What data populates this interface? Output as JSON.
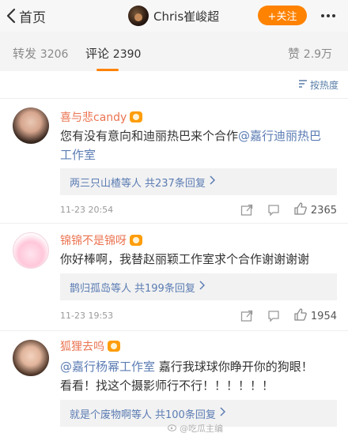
{
  "header": {
    "back_label": "首页",
    "username": "Chris崔峻超",
    "follow_label": "+关注",
    "more_icon": "more-icon"
  },
  "stats": {
    "repost_label": "转发",
    "repost_count": "3206",
    "comment_label": "评论",
    "comment_count": "2390",
    "like_label": "赞",
    "like_count": "2.9万"
  },
  "sort": {
    "label": "按热度"
  },
  "comments": [
    {
      "user": "喜与悲candy",
      "text_line1": "您有没有意向和迪丽热巴来个合作",
      "mention": "@嘉行迪丽热巴",
      "text_line2": "工作室",
      "reply_summary": "两三只山楂等人",
      "reply_count": "共237条回复",
      "time": "11-23 20:54",
      "likes": "2365"
    },
    {
      "user": "锦锦不是锦呀",
      "text_line1": "你好棒啊，我替赵丽颖工作室求个合作谢谢谢谢",
      "reply_summary": "鹊归孤岛等人",
      "reply_count": "共199条回复",
      "time": "11-23 19:53",
      "likes": "1954"
    },
    {
      "user": "狐狸去呜",
      "mention": "@嘉行杨幂工作室",
      "text_line1": " 嘉行我球球你睁开你的狗眼！",
      "text_line2": "看看！找这个摄影师行不行！！！！！！",
      "reply_summary": "就是个废物啊等人",
      "reply_count": "共100条回复"
    }
  ],
  "watermark": "@吃瓜主编",
  "colors": {
    "accent": "#ff8200",
    "username": "#eb7350",
    "link": "#5b7cb3"
  }
}
